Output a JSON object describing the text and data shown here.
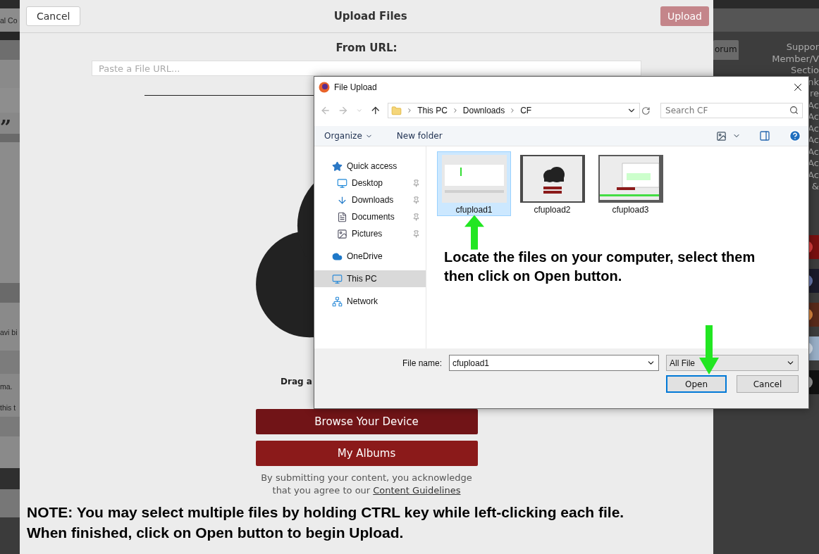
{
  "background_page": {
    "left_fragments": [
      "al Co",
      "”",
      "avi bi",
      "ma.",
      "this t"
    ],
    "right_tab": "orum",
    "right_lines": [
      "Suppor",
      "Member/V",
      "Sectio",
      "nk",
      "re",
      "Ac",
      "Ac",
      "Ac",
      "Ac",
      "Ac",
      "Ac",
      "Ac",
      "&"
    ]
  },
  "modal": {
    "cancel": "Cancel",
    "title": "Upload Files",
    "upload": "Upload",
    "url_heading": "From URL:",
    "url_placeholder": "Paste a File URL...",
    "drag_text": "Drag a",
    "browse": "Browse Your Device",
    "albums": "My Albums",
    "disclaimer_lines": [
      "By submitting your content, you acknowledge",
      "that you agree to our"
    ],
    "guidelines_link": "Content Guidelines"
  },
  "file_dialog": {
    "title": "File Upload",
    "breadcrumbs": [
      "This PC",
      "Downloads",
      "CF"
    ],
    "search_placeholder": "Search CF",
    "organize": "Organize",
    "new_folder": "New folder",
    "nav": [
      {
        "label": "Quick access",
        "kind": "star",
        "selected": false,
        "children": [
          {
            "label": "Desktop",
            "kind": "desktop",
            "pinned": true
          },
          {
            "label": "Downloads",
            "kind": "download",
            "pinned": true
          },
          {
            "label": "Documents",
            "kind": "document",
            "pinned": true
          },
          {
            "label": "Pictures",
            "kind": "pictures",
            "pinned": true
          }
        ]
      },
      {
        "label": "OneDrive",
        "kind": "cloud",
        "selected": false
      },
      {
        "label": "This PC",
        "kind": "computer",
        "selected": true
      },
      {
        "label": "Network",
        "kind": "network",
        "selected": false
      }
    ],
    "files": [
      {
        "name": "cfupload1",
        "kind": "picture",
        "selected": true
      },
      {
        "name": "cfupload2",
        "kind": "picture",
        "selected": false
      },
      {
        "name": "cfupload3",
        "kind": "picture",
        "selected": false
      }
    ],
    "file_name_label": "File name:",
    "file_name": "cfupload1",
    "file_type": "All File",
    "open": "Open",
    "cancel": "Cancel"
  },
  "annotations": {
    "locate_lines": [
      "Locate the files on your computer, select them",
      "then click on Open button."
    ],
    "note_lines": [
      "NOTE: You may select multiple files by holding CTRL key while left-clicking each file.",
      "When finished, click on Open button to begin Upload."
    ]
  }
}
